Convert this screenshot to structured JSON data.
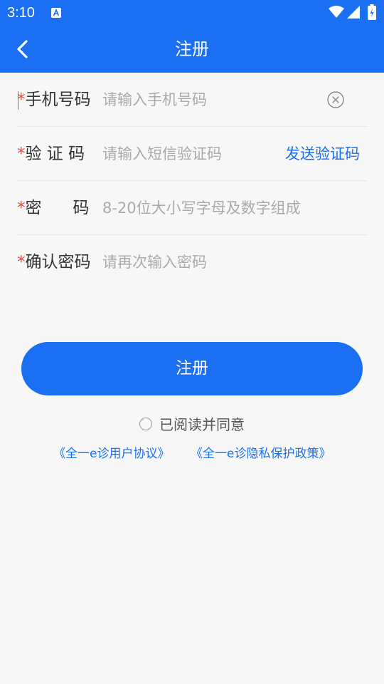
{
  "status_bar": {
    "time": "3:10"
  },
  "header": {
    "title": "注册",
    "back_icon": "chevron-left-icon"
  },
  "colors": {
    "primary": "#1a6ff2",
    "required": "#e84b3c",
    "placeholder": "#aaaaaa"
  },
  "form": {
    "required_mark": "*",
    "phone": {
      "label": "手机号码",
      "placeholder": "请输入手机号码",
      "value": "",
      "clear_icon": "clear-circle-icon"
    },
    "code": {
      "label": "验 证 码",
      "placeholder": "请输入短信验证码",
      "value": "",
      "send_label": "发送验证码"
    },
    "password": {
      "label": "密      码",
      "placeholder": "8-20位大小写字母及数字组成",
      "value": ""
    },
    "confirm": {
      "label": "确认密码",
      "placeholder": "请再次输入密码",
      "value": ""
    }
  },
  "submit_label": "注册",
  "agreement": {
    "checked": false,
    "text": "已阅读并同意",
    "user_agreement": "《全一e诊用户协议》",
    "privacy_policy": "《全一e诊隐私保护政策》"
  }
}
